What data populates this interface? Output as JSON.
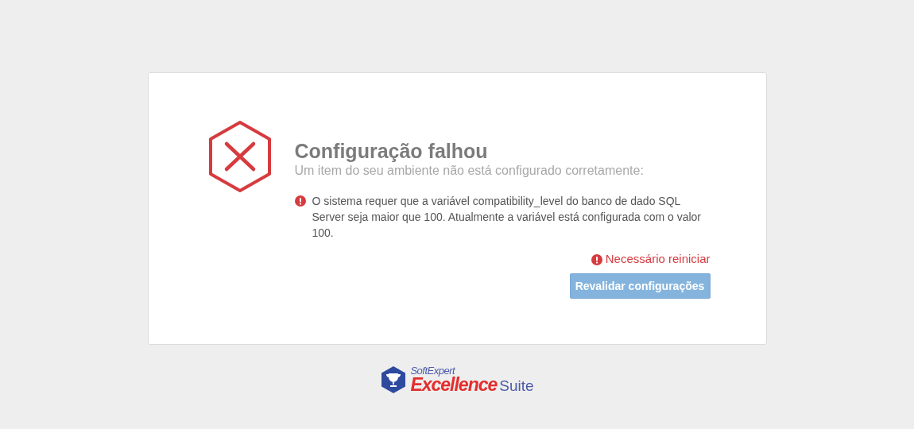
{
  "title": "Configuração falhou",
  "subtitle": "Um item do seu ambiente não está configurado corretamente:",
  "errors": [
    {
      "text": "O sistema requer que a variável compatibility_level do banco de dado SQL Server seja maior que 100. Atualmente a variável está configurada com o valor 100."
    }
  ],
  "restart_notice": "Necessário reiniciar",
  "revalidate_button": {
    "label": "Revalidar configurações",
    "disabled": true
  },
  "logo": {
    "brand": "SoftExpert",
    "product": "Excellence",
    "suffix": "Suite"
  }
}
